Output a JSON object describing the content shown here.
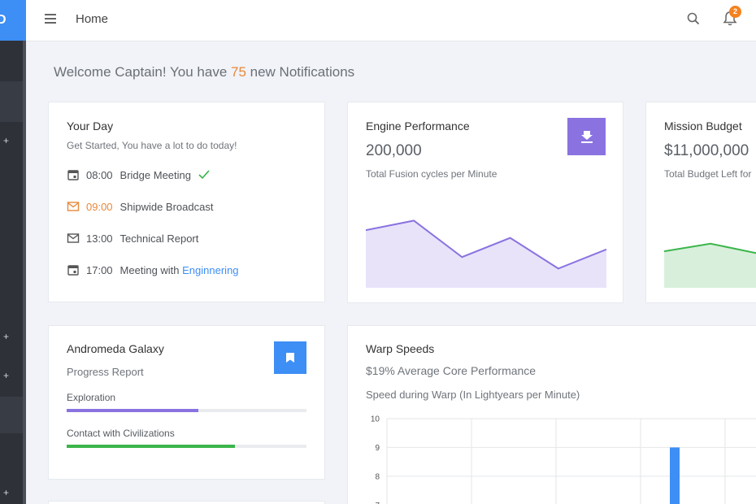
{
  "topbar": {
    "title": "Home",
    "notification_count": "2"
  },
  "sidebar": {
    "logo_text": "D",
    "expand_symbol": "+"
  },
  "welcome": {
    "prefix": "Welcome Captain! You have ",
    "count": "75",
    "suffix": " new Notifications"
  },
  "your_day": {
    "title": "Your Day",
    "subtitle": "Get Started, You have a lot to do today!",
    "items": [
      {
        "time": "08:00",
        "text": "Bridge Meeting",
        "icon": "calendar-icon",
        "done": true
      },
      {
        "time": "09:00",
        "text": "Shipwide Broadcast",
        "icon": "mail-icon"
      },
      {
        "time": "13:00",
        "text": "Technical Report",
        "icon": "mail-icon"
      },
      {
        "time": "17:00",
        "text": "Meeting with ",
        "link": "Enginnering",
        "icon": "calendar-icon"
      }
    ]
  },
  "engine": {
    "title": "Engine Performance",
    "value": "200,000",
    "caption": "Total Fusion cycles per Minute",
    "color": "#8a72e0"
  },
  "budget": {
    "title": "Mission Budget",
    "value": "$11,000,000",
    "caption": "Total Budget Left for",
    "color": "#3bb54a"
  },
  "andromeda": {
    "title": "Andromeda Galaxy",
    "subtitle": "Progress Report",
    "bars": [
      {
        "label": "Exploration",
        "value": 0.55,
        "color": "#8a72e0"
      },
      {
        "label": "Contact with Civilizations",
        "value": 0.7,
        "color": "#3bb54a"
      }
    ]
  },
  "warp": {
    "title": "Warp Speeds",
    "subtitle": "$19% Average Core Performance",
    "caption": "Speed during Warp (In Lightyears per Minute)"
  },
  "chart_data": [
    {
      "type": "area",
      "series": [
        {
          "values": [
            6,
            7,
            3.2,
            5.2,
            2,
            4
          ]
        }
      ],
      "ylim": [
        0,
        10
      ],
      "color": "#8a72e0"
    },
    {
      "type": "area",
      "series": [
        {
          "values": [
            3.8,
            4.6,
            3.6
          ]
        }
      ],
      "ylim": [
        0,
        10
      ],
      "color": "#3bb54a"
    },
    {
      "type": "bar",
      "ylim": [
        6.5,
        10
      ],
      "yticks": [
        "10",
        "9",
        "8",
        "7"
      ],
      "series": [
        {
          "values": [
            9
          ]
        }
      ],
      "color": "#3d8ef5"
    }
  ]
}
